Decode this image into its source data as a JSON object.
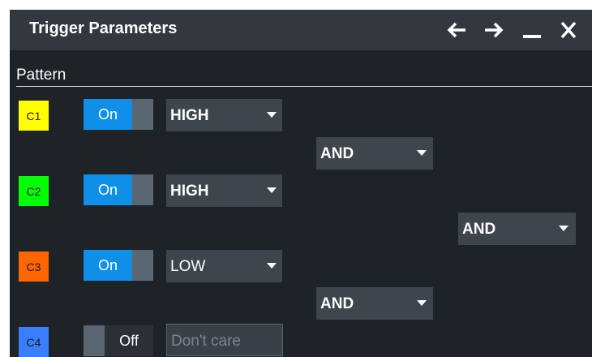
{
  "window": {
    "title": "Trigger Parameters",
    "icons": [
      "arrow-left-icon",
      "arrow-right-icon",
      "minimize-icon",
      "close-icon"
    ]
  },
  "section": {
    "label": "Pattern"
  },
  "channels": [
    {
      "label": "C1",
      "color": "#ffff00",
      "toggle": "On",
      "state": true,
      "level": "HIGH"
    },
    {
      "label": "C2",
      "color": "#00ff00",
      "toggle": "On",
      "state": true,
      "level": "HIGH"
    },
    {
      "label": "C3",
      "color": "#ff6600",
      "toggle": "On",
      "state": true,
      "level": "LOW"
    },
    {
      "label": "C4",
      "color": "#3a7dff",
      "toggle": "Off",
      "state": false,
      "level": "Don't care"
    }
  ],
  "logic": {
    "c1_c2": "AND",
    "combined": "AND",
    "c3_c4": "AND"
  },
  "colors": {
    "toggle_on": "#0f8fe8",
    "panel_bg": "#1e2328",
    "titlebar_bg": "#32383e"
  }
}
